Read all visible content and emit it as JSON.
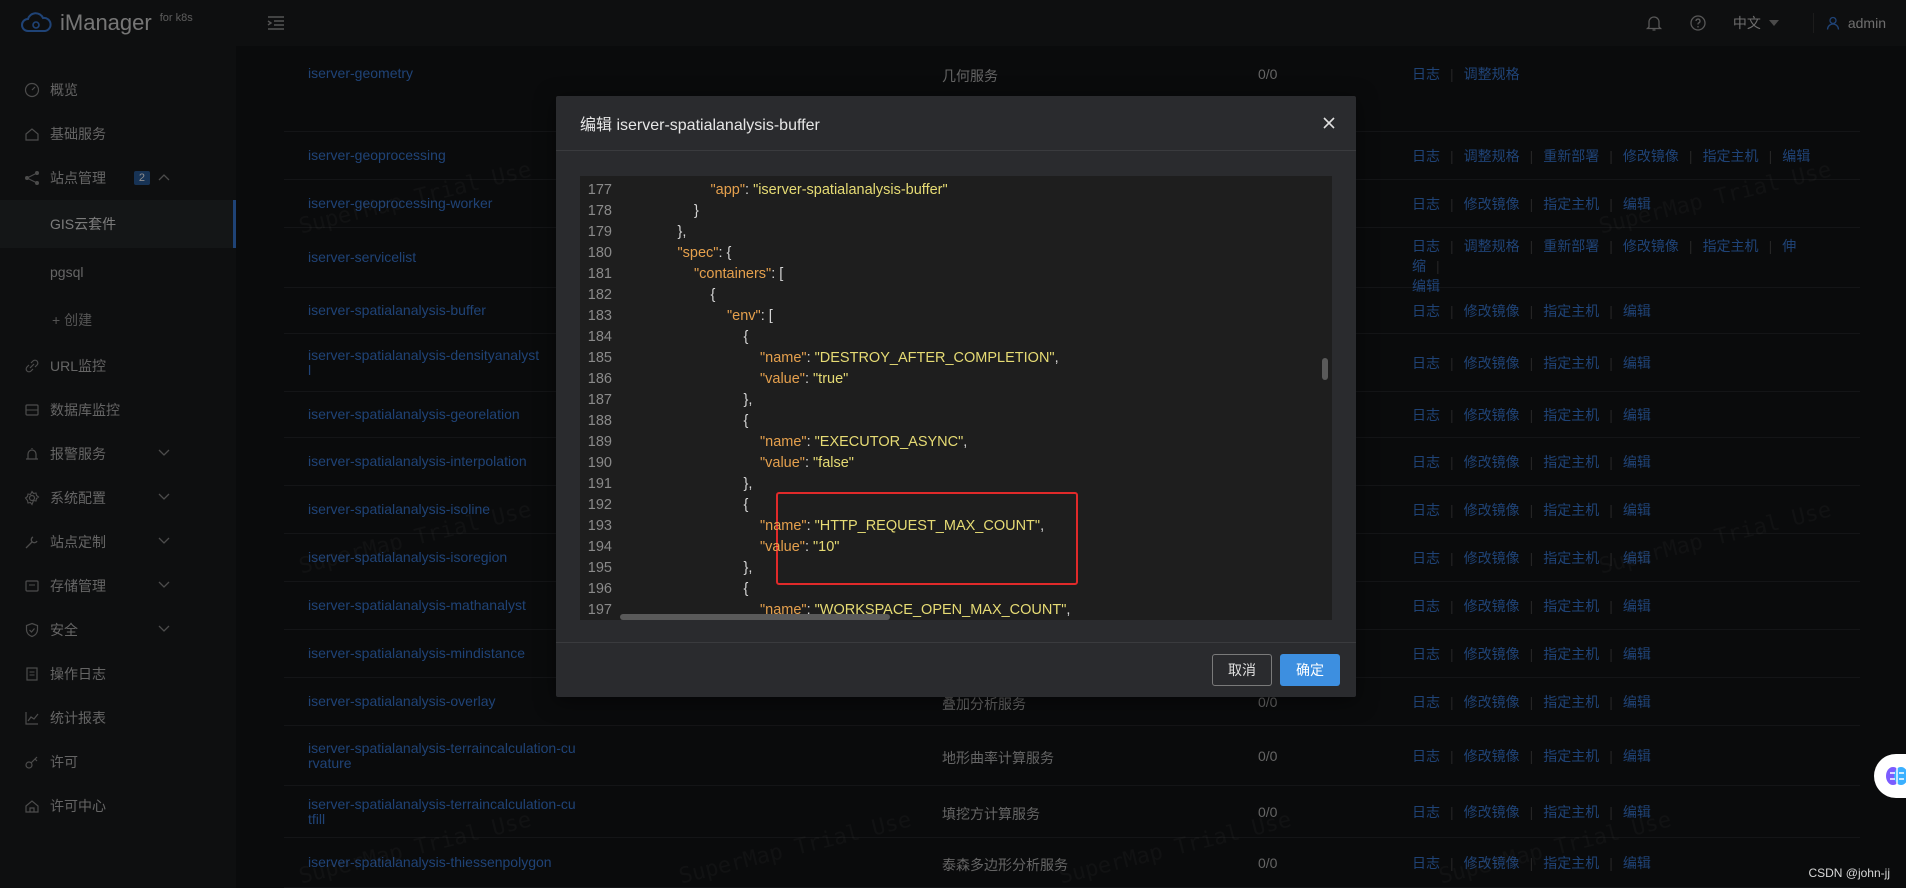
{
  "header": {
    "app_title": "iManager",
    "app_subtitle": "for k8s",
    "language": "中文",
    "user": "admin"
  },
  "sidebar": {
    "items": [
      {
        "label": "概览",
        "icon": "dashboard-icon"
      },
      {
        "label": "基础服务",
        "icon": "home-icon"
      },
      {
        "label": "站点管理",
        "icon": "share-icon",
        "badge": "2",
        "expanded": true
      },
      {
        "label": "URL监控",
        "icon": "link-icon"
      },
      {
        "label": "数据库监控",
        "icon": "database-icon"
      },
      {
        "label": "报警服务",
        "icon": "alarm-icon"
      },
      {
        "label": "系统配置",
        "icon": "gear-icon"
      },
      {
        "label": "站点定制",
        "icon": "wrench-icon"
      },
      {
        "label": "存储管理",
        "icon": "storage-icon"
      },
      {
        "label": "安全",
        "icon": "shield-icon"
      },
      {
        "label": "操作日志",
        "icon": "log-icon"
      },
      {
        "label": "统计报表",
        "icon": "chart-icon"
      },
      {
        "label": "许可",
        "icon": "key-icon"
      },
      {
        "label": "许可中心",
        "icon": "license-icon"
      }
    ],
    "sub_items": [
      "GIS云套件",
      "pgsql",
      "+ 创建"
    ]
  },
  "table": {
    "rows": [
      {
        "name": "iserver-geometry",
        "desc": "几何服务",
        "count": "0/0",
        "ops": [
          "日志",
          "调整规格"
        ]
      },
      {
        "name": "iserver-geoprocessing",
        "desc": "",
        "count": "",
        "ops": [
          "日志",
          "调整规格",
          "重新部署",
          "修改镜像",
          "指定主机",
          "编辑"
        ]
      },
      {
        "name": "iserver-geoprocessing-worker",
        "desc": "",
        "count": "",
        "ops": [
          "日志",
          "修改镜像",
          "指定主机",
          "编辑"
        ]
      },
      {
        "name": "iserver-servicelist",
        "desc": "",
        "count": "",
        "ops": [
          "日志",
          "调整规格",
          "重新部署",
          "修改镜像",
          "指定主机",
          "伸缩",
          "编辑"
        ]
      },
      {
        "name": "iserver-spatialanalysis-buffer",
        "desc": "",
        "count": "",
        "ops": [
          "日志",
          "修改镜像",
          "指定主机",
          "编辑"
        ]
      },
      {
        "name": "iserver-spatialanalysis-densityanalyst",
        "name2": "l",
        "desc": "",
        "count": "",
        "ops": [
          "日志",
          "修改镜像",
          "指定主机",
          "编辑"
        ]
      },
      {
        "name": "iserver-spatialanalysis-georelation",
        "desc": "",
        "count": "",
        "ops": [
          "日志",
          "修改镜像",
          "指定主机",
          "编辑"
        ]
      },
      {
        "name": "iserver-spatialanalysis-interpolation",
        "desc": "",
        "count": "",
        "ops": [
          "日志",
          "修改镜像",
          "指定主机",
          "编辑"
        ]
      },
      {
        "name": "iserver-spatialanalysis-isoline",
        "desc": "",
        "count": "",
        "ops": [
          "日志",
          "修改镜像",
          "指定主机",
          "编辑"
        ]
      },
      {
        "name": "iserver-spatialanalysis-isoregion",
        "desc": "",
        "count": "",
        "ops": [
          "日志",
          "修改镜像",
          "指定主机",
          "编辑"
        ]
      },
      {
        "name": "iserver-spatialanalysis-mathanalyst",
        "desc": "",
        "count": "",
        "ops": [
          "日志",
          "修改镜像",
          "指定主机",
          "编辑"
        ]
      },
      {
        "name": "iserver-spatialanalysis-mindistance",
        "desc": "",
        "count": "",
        "ops": [
          "日志",
          "修改镜像",
          "指定主机",
          "编辑"
        ]
      },
      {
        "name": "iserver-spatialanalysis-overlay",
        "desc": "叠加分析服务",
        "count": "0/0",
        "ops": [
          "日志",
          "修改镜像",
          "指定主机",
          "编辑"
        ]
      },
      {
        "name": "iserver-spatialanalysis-terraincalculation-cu",
        "name2": "rvature",
        "desc": "地形曲率计算服务",
        "count": "0/0",
        "ops": [
          "日志",
          "修改镜像",
          "指定主机",
          "编辑"
        ]
      },
      {
        "name": "iserver-spatialanalysis-terraincalculation-cu",
        "name2": "tfill",
        "desc": "填挖方计算服务",
        "count": "0/0",
        "ops": [
          "日志",
          "修改镜像",
          "指定主机",
          "编辑"
        ]
      },
      {
        "name": "iserver-spatialanalysis-thiessenpolygon",
        "desc": "泰森多边形分析服务",
        "count": "0/0",
        "ops": [
          "日志",
          "修改镜像",
          "指定主机",
          "编辑"
        ]
      }
    ]
  },
  "watermark": "SuperMap Trial Use",
  "modal": {
    "title": "编辑 iserver-spatialanalysis-buffer",
    "cancel_label": "取消",
    "ok_label": "确定",
    "code_lines": [
      {
        "n": "177",
        "indent": 5,
        "tokens": [
          [
            "k",
            "\"app\""
          ],
          [
            "p",
            ": "
          ],
          [
            "s",
            "\"iserver-spatialanalysis-buffer\""
          ]
        ]
      },
      {
        "n": "178",
        "indent": 4,
        "tokens": [
          [
            "p",
            "}"
          ]
        ]
      },
      {
        "n": "179",
        "indent": 3,
        "tokens": [
          [
            "p",
            "},"
          ]
        ]
      },
      {
        "n": "180",
        "indent": 3,
        "tokens": [
          [
            "k",
            "\"spec\""
          ],
          [
            "p",
            ": {"
          ]
        ]
      },
      {
        "n": "181",
        "indent": 4,
        "tokens": [
          [
            "k",
            "\"containers\""
          ],
          [
            "p",
            ": ["
          ]
        ]
      },
      {
        "n": "182",
        "indent": 5,
        "tokens": [
          [
            "p",
            "{"
          ]
        ]
      },
      {
        "n": "183",
        "indent": 6,
        "tokens": [
          [
            "k",
            "\"env\""
          ],
          [
            "p",
            ": ["
          ]
        ]
      },
      {
        "n": "184",
        "indent": 7,
        "tokens": [
          [
            "p",
            "{"
          ]
        ]
      },
      {
        "n": "185",
        "indent": 8,
        "tokens": [
          [
            "k",
            "\"name\""
          ],
          [
            "p",
            ": "
          ],
          [
            "s",
            "\"DESTROY_AFTER_COMPLETION\""
          ],
          [
            "p",
            ","
          ]
        ]
      },
      {
        "n": "186",
        "indent": 8,
        "tokens": [
          [
            "k",
            "\"value\""
          ],
          [
            "p",
            ": "
          ],
          [
            "s",
            "\"true\""
          ]
        ]
      },
      {
        "n": "187",
        "indent": 7,
        "tokens": [
          [
            "p",
            "},"
          ]
        ]
      },
      {
        "n": "188",
        "indent": 7,
        "tokens": [
          [
            "p",
            "{"
          ]
        ]
      },
      {
        "n": "189",
        "indent": 8,
        "tokens": [
          [
            "k",
            "\"name\""
          ],
          [
            "p",
            ": "
          ],
          [
            "s",
            "\"EXECUTOR_ASYNC\""
          ],
          [
            "p",
            ","
          ]
        ]
      },
      {
        "n": "190",
        "indent": 8,
        "tokens": [
          [
            "k",
            "\"value\""
          ],
          [
            "p",
            ": "
          ],
          [
            "s",
            "\"false\""
          ]
        ]
      },
      {
        "n": "191",
        "indent": 7,
        "tokens": [
          [
            "p",
            "},"
          ]
        ]
      },
      {
        "n": "192",
        "indent": 7,
        "tokens": [
          [
            "p",
            "{"
          ]
        ]
      },
      {
        "n": "193",
        "indent": 8,
        "tokens": [
          [
            "k",
            "\"name\""
          ],
          [
            "p",
            ": "
          ],
          [
            "s",
            "\"HTTP_REQUEST_MAX_COUNT\""
          ],
          [
            "p",
            ","
          ]
        ]
      },
      {
        "n": "194",
        "indent": 8,
        "tokens": [
          [
            "k",
            "\"value\""
          ],
          [
            "p",
            ": "
          ],
          [
            "s",
            "\"10\""
          ]
        ]
      },
      {
        "n": "195",
        "indent": 7,
        "tokens": [
          [
            "p",
            "},"
          ]
        ]
      },
      {
        "n": "196",
        "indent": 7,
        "tokens": [
          [
            "p",
            "{"
          ]
        ]
      },
      {
        "n": "197",
        "indent": 8,
        "tokens": [
          [
            "k",
            "\"name\""
          ],
          [
            "p",
            ": "
          ],
          [
            "s",
            "\"WORKSPACE_OPEN_MAX_COUNT\""
          ],
          [
            "p",
            ","
          ]
        ]
      }
    ]
  },
  "footer_credit": "CSDN @john-jj",
  "colors": {
    "accent": "#3a7ad8",
    "primary_button": "#3d8fe0",
    "json_key": "#e5a04d",
    "json_string": "#e6db74",
    "highlight_border": "#e02a2a"
  }
}
